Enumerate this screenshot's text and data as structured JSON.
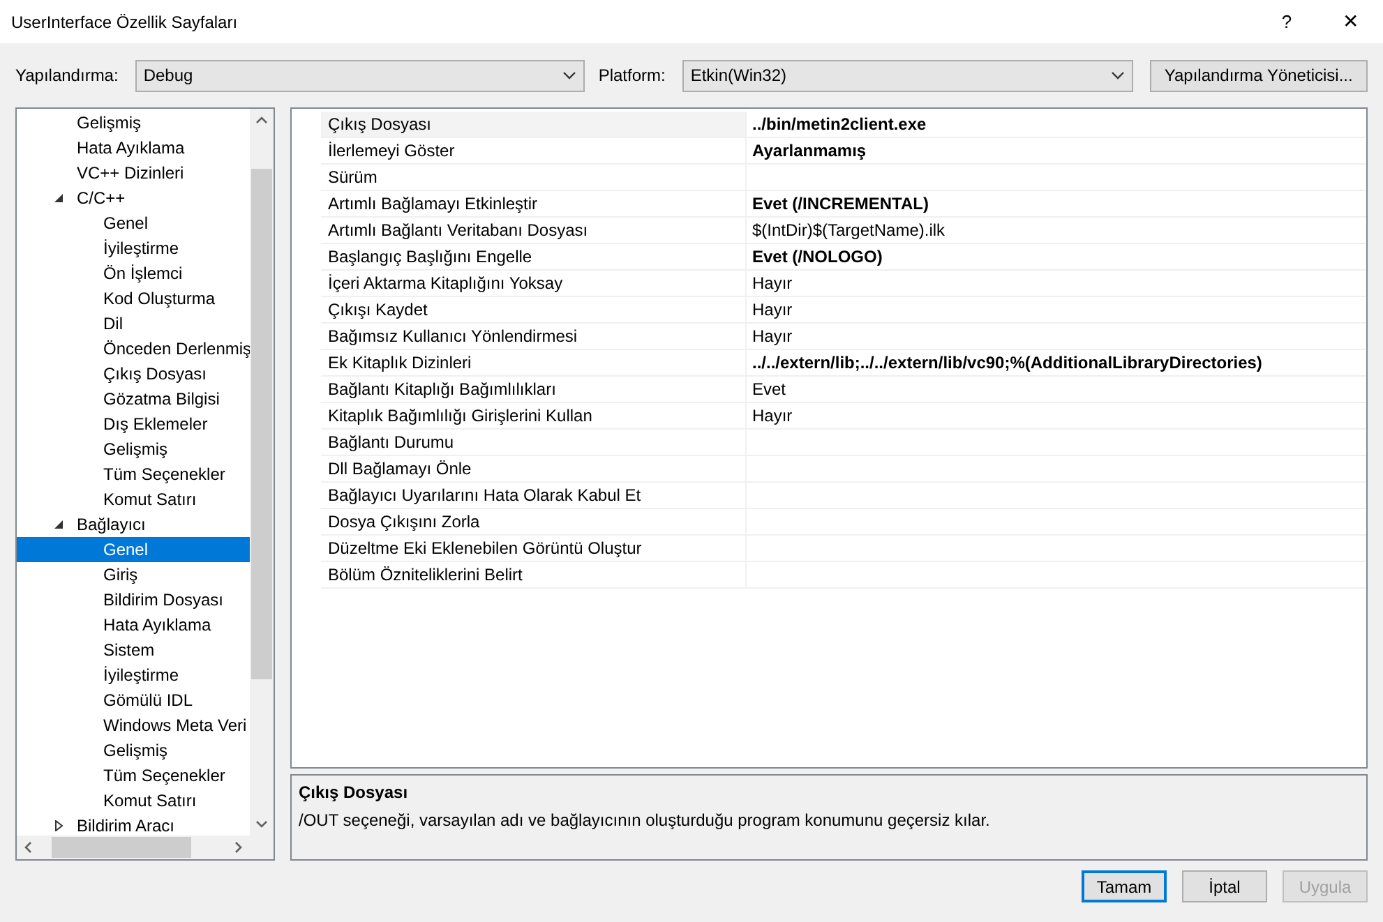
{
  "window": {
    "title": "UserInterface Özellik Sayfaları",
    "help_button": "?",
    "close_button": "✕"
  },
  "toolbar": {
    "configuration_label": "Yapılandırma:",
    "configuration_value": "Debug",
    "platform_label": "Platform:",
    "platform_value": "Etkin(Win32)",
    "manager_button": "Yapılandırma Yöneticisi..."
  },
  "tree": [
    {
      "label": "Gelişmiş",
      "selected": false
    },
    {
      "label": "Hata Ayıklama",
      "selected": false
    },
    {
      "label": "VC++ Dizinleri",
      "selected": false
    },
    {
      "label": "C/C++",
      "selected": false,
      "expanded": true,
      "children": [
        {
          "label": "Genel",
          "selected": false
        },
        {
          "label": "İyileştirme",
          "selected": false
        },
        {
          "label": "Ön İşlemci",
          "selected": false
        },
        {
          "label": "Kod Oluşturma",
          "selected": false
        },
        {
          "label": "Dil",
          "selected": false
        },
        {
          "label": "Önceden Derlenmiş",
          "selected": false
        },
        {
          "label": "Çıkış Dosyası",
          "selected": false
        },
        {
          "label": "Gözatma Bilgisi",
          "selected": false
        },
        {
          "label": "Dış Eklemeler",
          "selected": false
        },
        {
          "label": "Gelişmiş",
          "selected": false
        },
        {
          "label": "Tüm Seçenekler",
          "selected": false
        },
        {
          "label": "Komut Satırı",
          "selected": false
        }
      ]
    },
    {
      "label": "Bağlayıcı",
      "selected": false,
      "expanded": true,
      "children": [
        {
          "label": "Genel",
          "selected": true
        },
        {
          "label": "Giriş",
          "selected": false
        },
        {
          "label": "Bildirim Dosyası",
          "selected": false
        },
        {
          "label": "Hata Ayıklama",
          "selected": false
        },
        {
          "label": "Sistem",
          "selected": false
        },
        {
          "label": "İyileştirme",
          "selected": false
        },
        {
          "label": "Gömülü IDL",
          "selected": false
        },
        {
          "label": "Windows Meta Veri",
          "selected": false
        },
        {
          "label": "Gelişmiş",
          "selected": false
        },
        {
          "label": "Tüm Seçenekler",
          "selected": false
        },
        {
          "label": "Komut Satırı",
          "selected": false
        }
      ]
    },
    {
      "label": "Bildirim Aracı",
      "selected": false,
      "expanded": false
    }
  ],
  "properties": [
    {
      "name": "Çıkış Dosyası",
      "value": "../bin/metin2client.exe",
      "modified": true,
      "selected": true
    },
    {
      "name": "İlerlemeyi Göster",
      "value": "Ayarlanmamış",
      "modified": true,
      "selected": false
    },
    {
      "name": "Sürüm",
      "selected": false
    },
    {
      "name": "Artımlı Bağlamayı Etkinleştir",
      "value": "Evet (/INCREMENTAL)",
      "modified": true,
      "selected": false
    },
    {
      "name": "Artımlı Bağlantı Veritabanı Dosyası",
      "value": "$(IntDir)$(TargetName).ilk",
      "modified": false,
      "selected": false
    },
    {
      "name": "Başlangıç Başlığını Engelle",
      "value": "Evet (/NOLOGO)",
      "modified": true,
      "selected": false
    },
    {
      "name": "İçeri Aktarma Kitaplığını Yoksay",
      "value": "Hayır",
      "modified": false,
      "selected": false
    },
    {
      "name": "Çıkışı Kaydet",
      "value": "Hayır",
      "modified": false,
      "selected": false
    },
    {
      "name": "Bağımsız Kullanıcı Yönlendirmesi",
      "value": "Hayır",
      "modified": false,
      "selected": false
    },
    {
      "name": "Ek Kitaplık Dizinleri",
      "value": "../../extern/lib;../../extern/lib/vc90;%(AdditionalLibraryDirectories)",
      "modified": true,
      "selected": false
    },
    {
      "name": "Bağlantı Kitaplığı Bağımlılıkları",
      "value": "Evet",
      "modified": false,
      "selected": false
    },
    {
      "name": "Kitaplık Bağımlılığı Girişlerini Kullan",
      "value": "Hayır",
      "modified": false,
      "selected": false
    },
    {
      "name": "Bağlantı Durumu",
      "selected": false
    },
    {
      "name": "Dll Bağlamayı Önle",
      "selected": false
    },
    {
      "name": "Bağlayıcı Uyarılarını Hata Olarak Kabul Et",
      "selected": false
    },
    {
      "name": "Dosya Çıkışını Zorla",
      "selected": false
    },
    {
      "name": "Düzeltme Eki Eklenebilen Görüntü Oluştur",
      "selected": false
    },
    {
      "name": "Bölüm Özniteliklerini Belirt",
      "selected": false
    }
  ],
  "description": {
    "title": "Çıkış Dosyası",
    "text": "/OUT seçeneği, varsayılan adı ve bağlayıcının oluşturduğu program konumunu geçersiz kılar."
  },
  "buttons": [
    {
      "label": "Tamam",
      "default": true,
      "disabled": false
    },
    {
      "label": "İptal",
      "default": false,
      "disabled": false
    },
    {
      "label": "Uygula",
      "default": false,
      "disabled": true
    }
  ]
}
